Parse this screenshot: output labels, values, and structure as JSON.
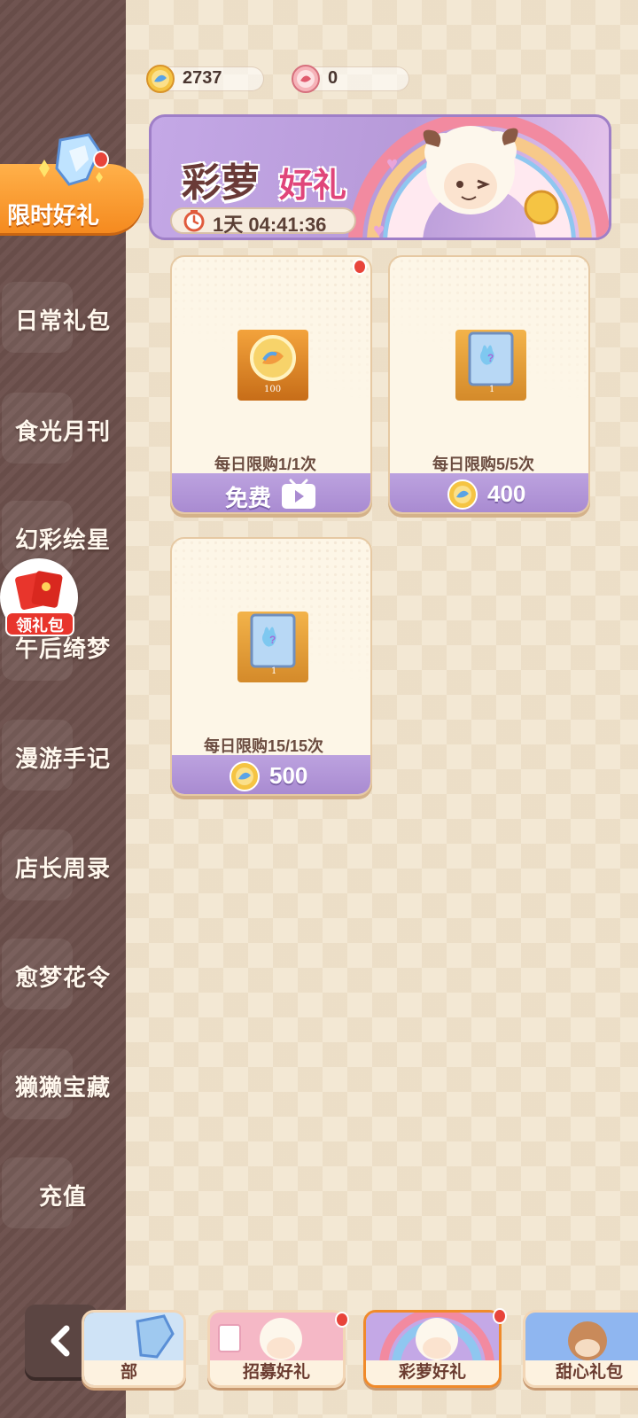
{
  "currency": {
    "coin_amount": "2737",
    "ticket_amount": "0"
  },
  "sidebar": {
    "active_label": "限时好礼",
    "items": [
      {
        "label": "日常礼包"
      },
      {
        "label": "食光月刊"
      },
      {
        "label": "幻彩绘星"
      },
      {
        "label": "午后绮梦"
      },
      {
        "label": "漫游手记"
      },
      {
        "label": "店长周录"
      },
      {
        "label": "愈梦花令"
      },
      {
        "label": "獭獭宝藏"
      },
      {
        "label": "充值"
      }
    ],
    "redpack_label": "领礼包"
  },
  "banner": {
    "title_main": "彩萝",
    "title_accent": "好礼",
    "countdown": "1天 04:41:36"
  },
  "cards": [
    {
      "limit": "每日限购1/1次",
      "price": "免费",
      "item_qty": "100",
      "has_dot": true
    },
    {
      "limit": "每日限购5/5次",
      "price": "400",
      "item_qty": "1",
      "has_dot": false
    },
    {
      "limit": "每日限购15/15次",
      "price": "500",
      "item_qty": "1",
      "has_dot": false
    }
  ],
  "bottom_tabs": [
    {
      "label": "部"
    },
    {
      "label": "招募好礼"
    },
    {
      "label": "彩萝好礼"
    },
    {
      "label": "甜心礼包"
    }
  ],
  "colors": {
    "sidebar_bg": "#6b4f4b",
    "active_tab": "#f58a1f",
    "card_footer": "#a98bd1",
    "banner": "#b79ad9"
  }
}
